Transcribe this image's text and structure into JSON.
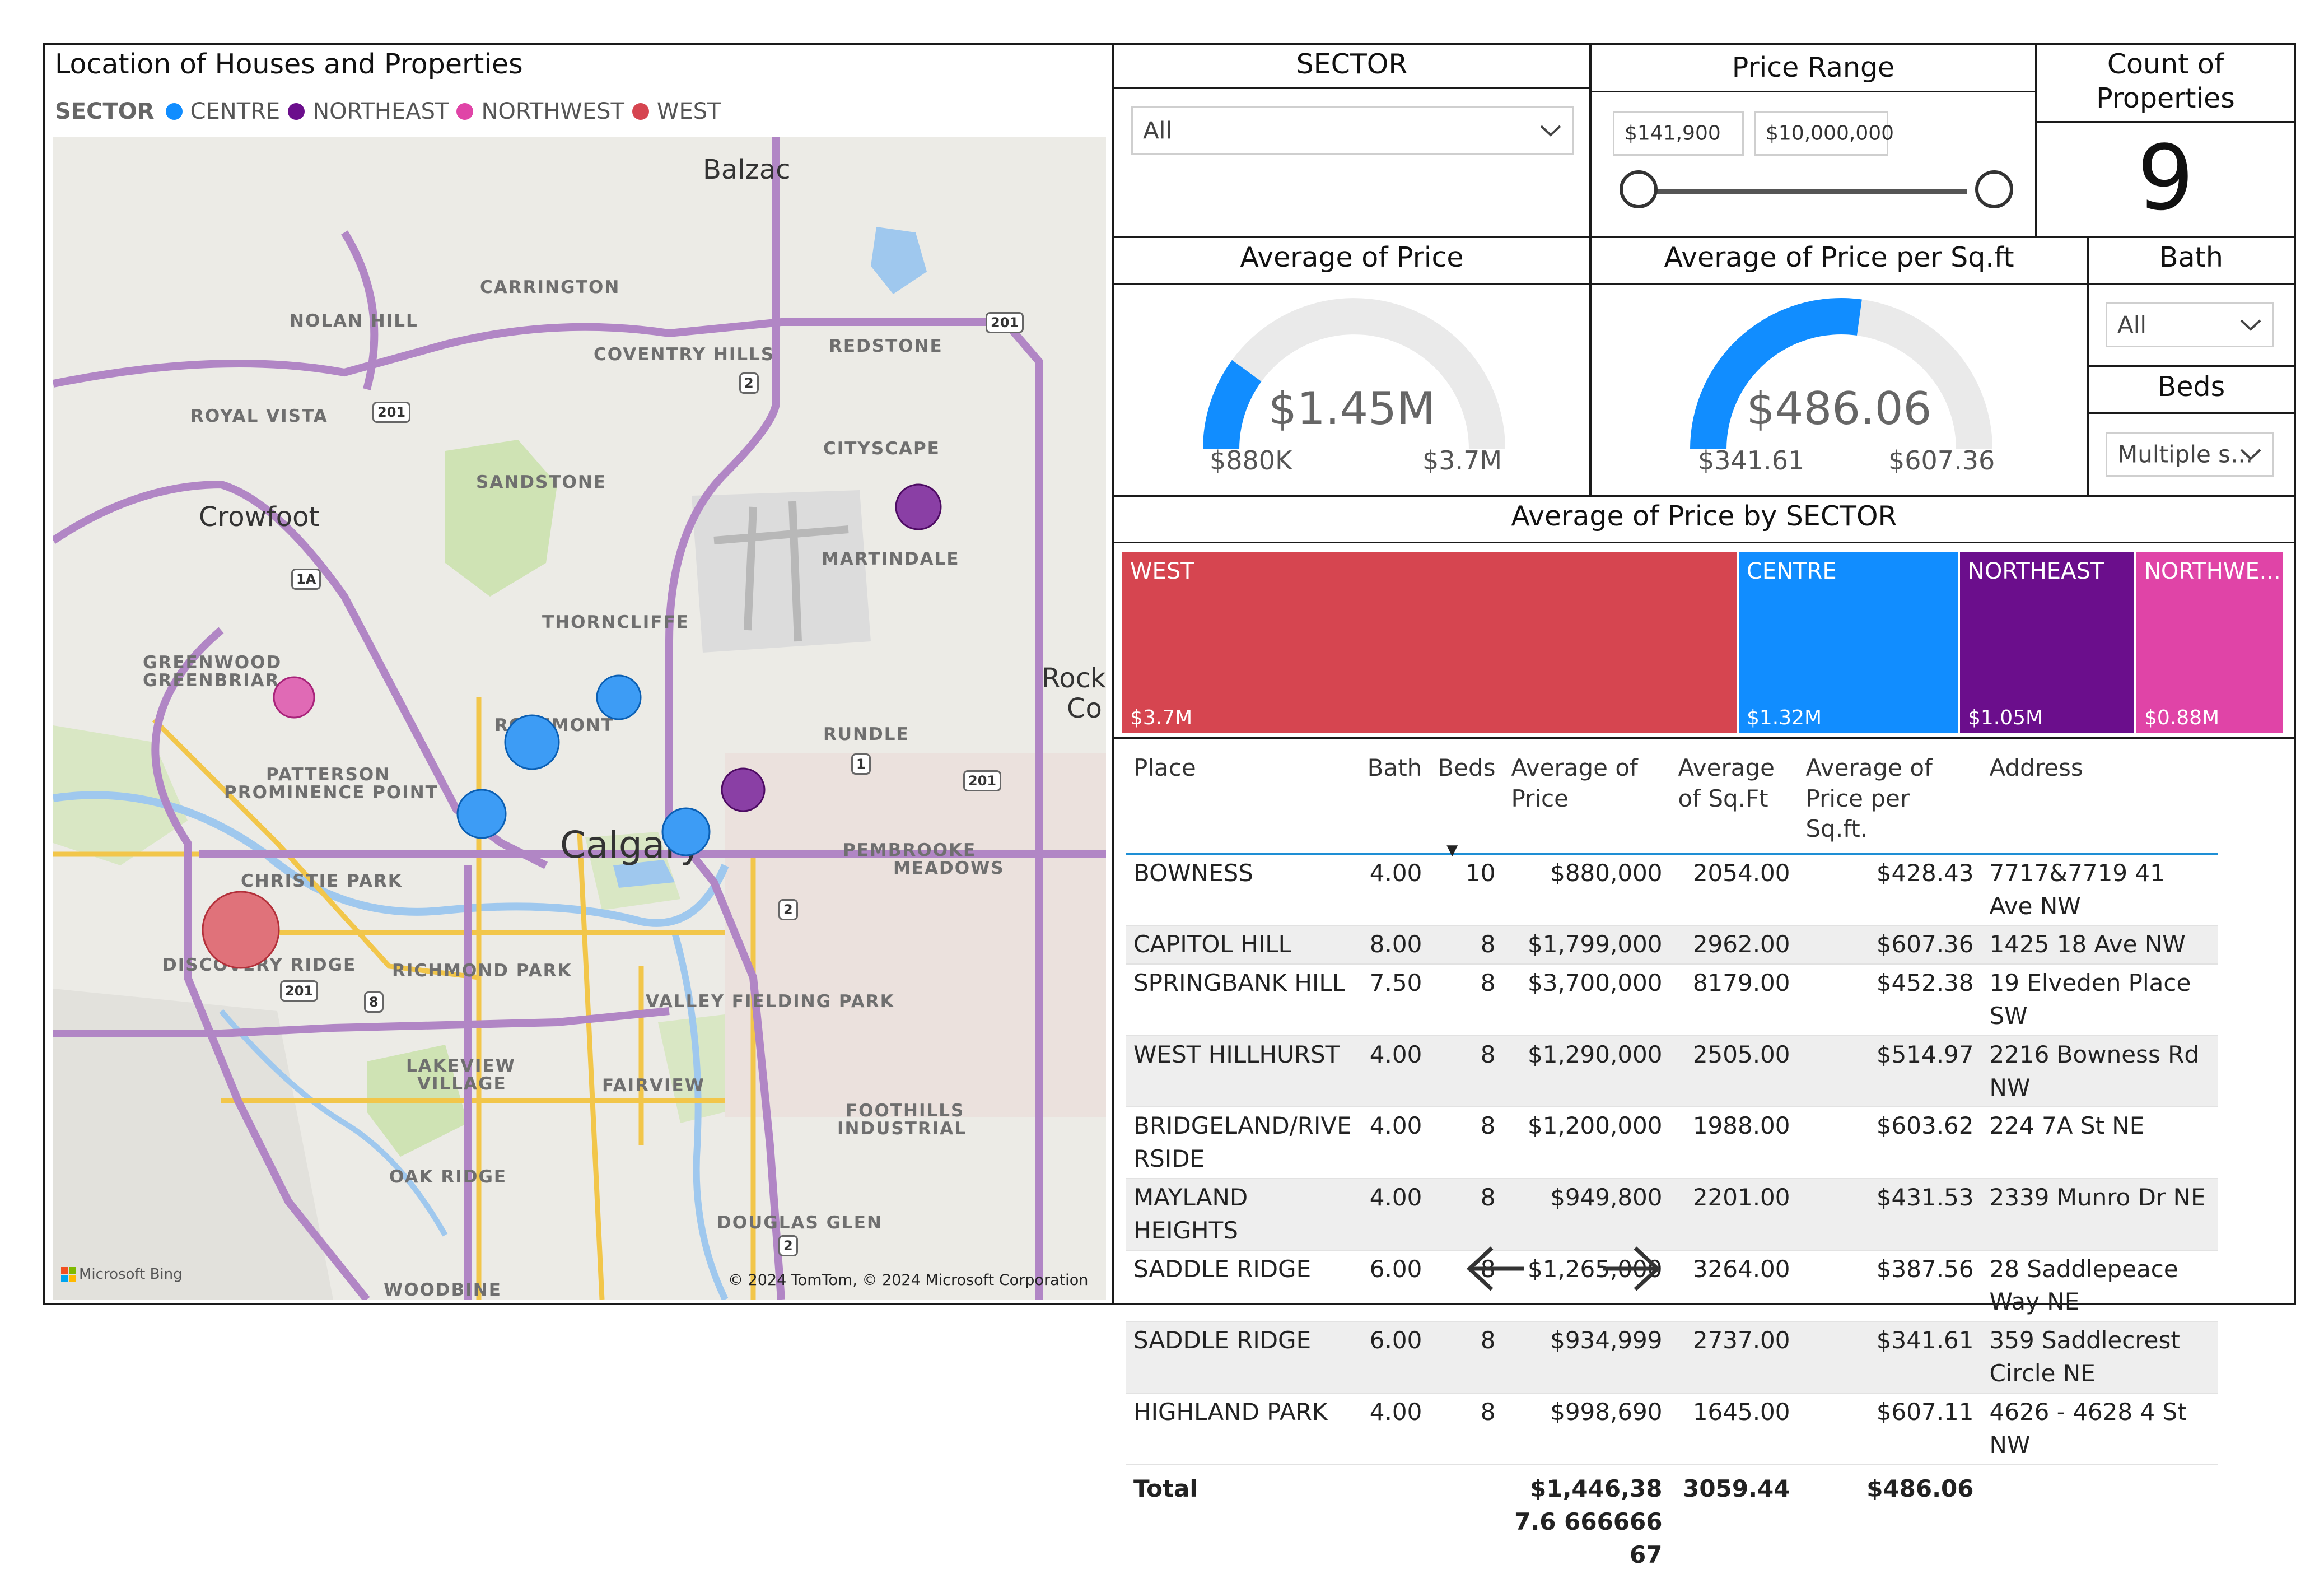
{
  "map": {
    "title": "Location of Houses and Properties",
    "legend_title": "SECTOR",
    "legend": [
      {
        "label": "CENTRE",
        "color": "#118dff"
      },
      {
        "label": "NORTHEAST",
        "color": "#6b0e8c"
      },
      {
        "label": "NORTHWEST",
        "color": "#e044a7"
      },
      {
        "label": "WEST",
        "color": "#d64550"
      }
    ],
    "labels": {
      "balzac": "Balzac",
      "carrington": "CARRINGTON",
      "nolan_hill": "NOLAN HILL",
      "coventry_hills": "COVENTRY HILLS",
      "redstone": "REDSTONE",
      "royal_vista": "ROYAL VISTA",
      "cityscape": "CITYSCAPE",
      "sandstone": "SANDSTONE",
      "crowfoot": "Crowfoot",
      "martindale": "MARTINDALE",
      "thorncliffe": "THORNCLIFFE",
      "greenwood": "GREENWOOD",
      "greenbriar": "GREENBRIAR",
      "rock": "Rock",
      "co": "Co",
      "rosemont": "ROSEMONT",
      "rundle": "RUNDLE",
      "patterson": "PATTERSON",
      "prominence_point": "PROMINENCE POINT",
      "calgary": "Calgary",
      "pembrooke": "PEMBROOKE",
      "meadows": "MEADOWS",
      "christie_park": "CHRISTIE PARK",
      "discovery_ridge": "DISCOVERY RIDGE",
      "richmond_park": "RICHMOND PARK",
      "valley_fielding_park": "VALLEY FIELDING PARK",
      "lakeview": "LAKEVIEW",
      "village": "VILLAGE",
      "fairview": "FAIRVIEW",
      "foothills": "FOOTHILLS",
      "industrial": "INDUSTRIAL",
      "oak_ridge": "OAK RIDGE",
      "douglas_glen": "DOUGLAS GLEN",
      "woodbine": "WOODBINE"
    },
    "shields": {
      "s201a": "201",
      "s2a": "2",
      "s201b": "201",
      "s1a": "1A",
      "s1": "1",
      "s201c": "201",
      "s2b": "2",
      "s201d": "201",
      "s8": "8",
      "s2c": "2"
    },
    "bing_logo": "Microsoft Bing",
    "copyright": "© 2024 TomTom, © 2024 Microsoft Corporation"
  },
  "sector_slicer": {
    "title": "SECTOR",
    "value": "All"
  },
  "price_range": {
    "title": "Price Range",
    "min": "$141,900",
    "max": "$10,000,000"
  },
  "count_card": {
    "title": "Count of Properties",
    "value": "9"
  },
  "avg_price_gauge": {
    "title": "Average of Price",
    "value_label": "$1.45M",
    "min_label": "$880K",
    "max_label": "$3.7M",
    "value": 1446387.67,
    "min": 880000,
    "max": 3700000
  },
  "avg_ppsf_gauge": {
    "title": "Average of Price per Sq.ft",
    "value_label": "$486.06",
    "min_label": "$341.61",
    "max_label": "$607.36",
    "value": 486.06,
    "min": 341.61,
    "max": 607.36
  },
  "bath_slicer": {
    "title": "Bath",
    "value": "All"
  },
  "beds_slicer": {
    "title": "Beds",
    "value": "Multiple s..."
  },
  "treemap": {
    "title": "Average of Price by SECTOR",
    "items": [
      {
        "label": "WEST",
        "value_label": "$3.7M",
        "value": 3.7,
        "color": "#d64550"
      },
      {
        "label": "CENTRE",
        "value_label": "$1.32M",
        "value": 1.32,
        "color": "#118dff"
      },
      {
        "label": "NORTHEAST",
        "value_label": "$1.05M",
        "value": 1.05,
        "color": "#6b0e8c"
      },
      {
        "label": "NORTHWE...",
        "value_label": "$0.88M",
        "value": 0.88,
        "color": "#e044a7"
      }
    ]
  },
  "table": {
    "headers": {
      "place": "Place",
      "bath": "Bath",
      "beds": "Beds",
      "avg_price_1": "Average of",
      "avg_price_2": "Price",
      "avg_sqft_1": "Average",
      "avg_sqft_2": "of Sq.Ft",
      "avg_ppsf_1": "Average of",
      "avg_ppsf_2": "Price per Sq.ft.",
      "address": "Address"
    },
    "sort_indicator": "▼",
    "rows": [
      {
        "place": "BOWNESS",
        "bath": "4.00",
        "beds": "10",
        "price": "$880,000",
        "sqft": "2054.00",
        "ppsf": "$428.43",
        "address": "7717&7719 41 Ave NW"
      },
      {
        "place": "CAPITOL HILL",
        "bath": "8.00",
        "beds": "8",
        "price": "$1,799,000",
        "sqft": "2962.00",
        "ppsf": "$607.36",
        "address": "1425 18 Ave NW"
      },
      {
        "place": "SPRINGBANK HILL",
        "bath": "7.50",
        "beds": "8",
        "price": "$3,700,000",
        "sqft": "8179.00",
        "ppsf": "$452.38",
        "address": "19 Elveden Place SW"
      },
      {
        "place": "WEST HILLHURST",
        "bath": "4.00",
        "beds": "8",
        "price": "$1,290,000",
        "sqft": "2505.00",
        "ppsf": "$514.97",
        "address": "2216 Bowness Rd NW"
      },
      {
        "place": "BRIDGELAND/RIVE RSIDE",
        "bath": "4.00",
        "beds": "8",
        "price": "$1,200,000",
        "sqft": "1988.00",
        "ppsf": "$603.62",
        "address": "224 7A St NE"
      },
      {
        "place": "MAYLAND HEIGHTS",
        "bath": "4.00",
        "beds": "8",
        "price": "$949,800",
        "sqft": "2201.00",
        "ppsf": "$431.53",
        "address": "2339 Munro Dr NE"
      },
      {
        "place": "SADDLE RIDGE",
        "bath": "6.00",
        "beds": "8",
        "price": "$1,265,000",
        "sqft": "3264.00",
        "ppsf": "$387.56",
        "address": "28 Saddlepeace Way NE"
      },
      {
        "place": "SADDLE RIDGE",
        "bath": "6.00",
        "beds": "8",
        "price": "$934,999",
        "sqft": "2737.00",
        "ppsf": "$341.61",
        "address": "359 Saddlecrest Circle NE"
      },
      {
        "place": "HIGHLAND PARK",
        "bath": "4.00",
        "beds": "8",
        "price": "$998,690",
        "sqft": "1645.00",
        "ppsf": "$607.11",
        "address": "4626 - 4628 4 St NW"
      }
    ],
    "total": {
      "label": "Total",
      "price": "$1,446,387.6 66666667",
      "sqft": "3059.44",
      "ppsf": "$486.06"
    }
  },
  "nav": {
    "prev": "←",
    "next": "→"
  }
}
